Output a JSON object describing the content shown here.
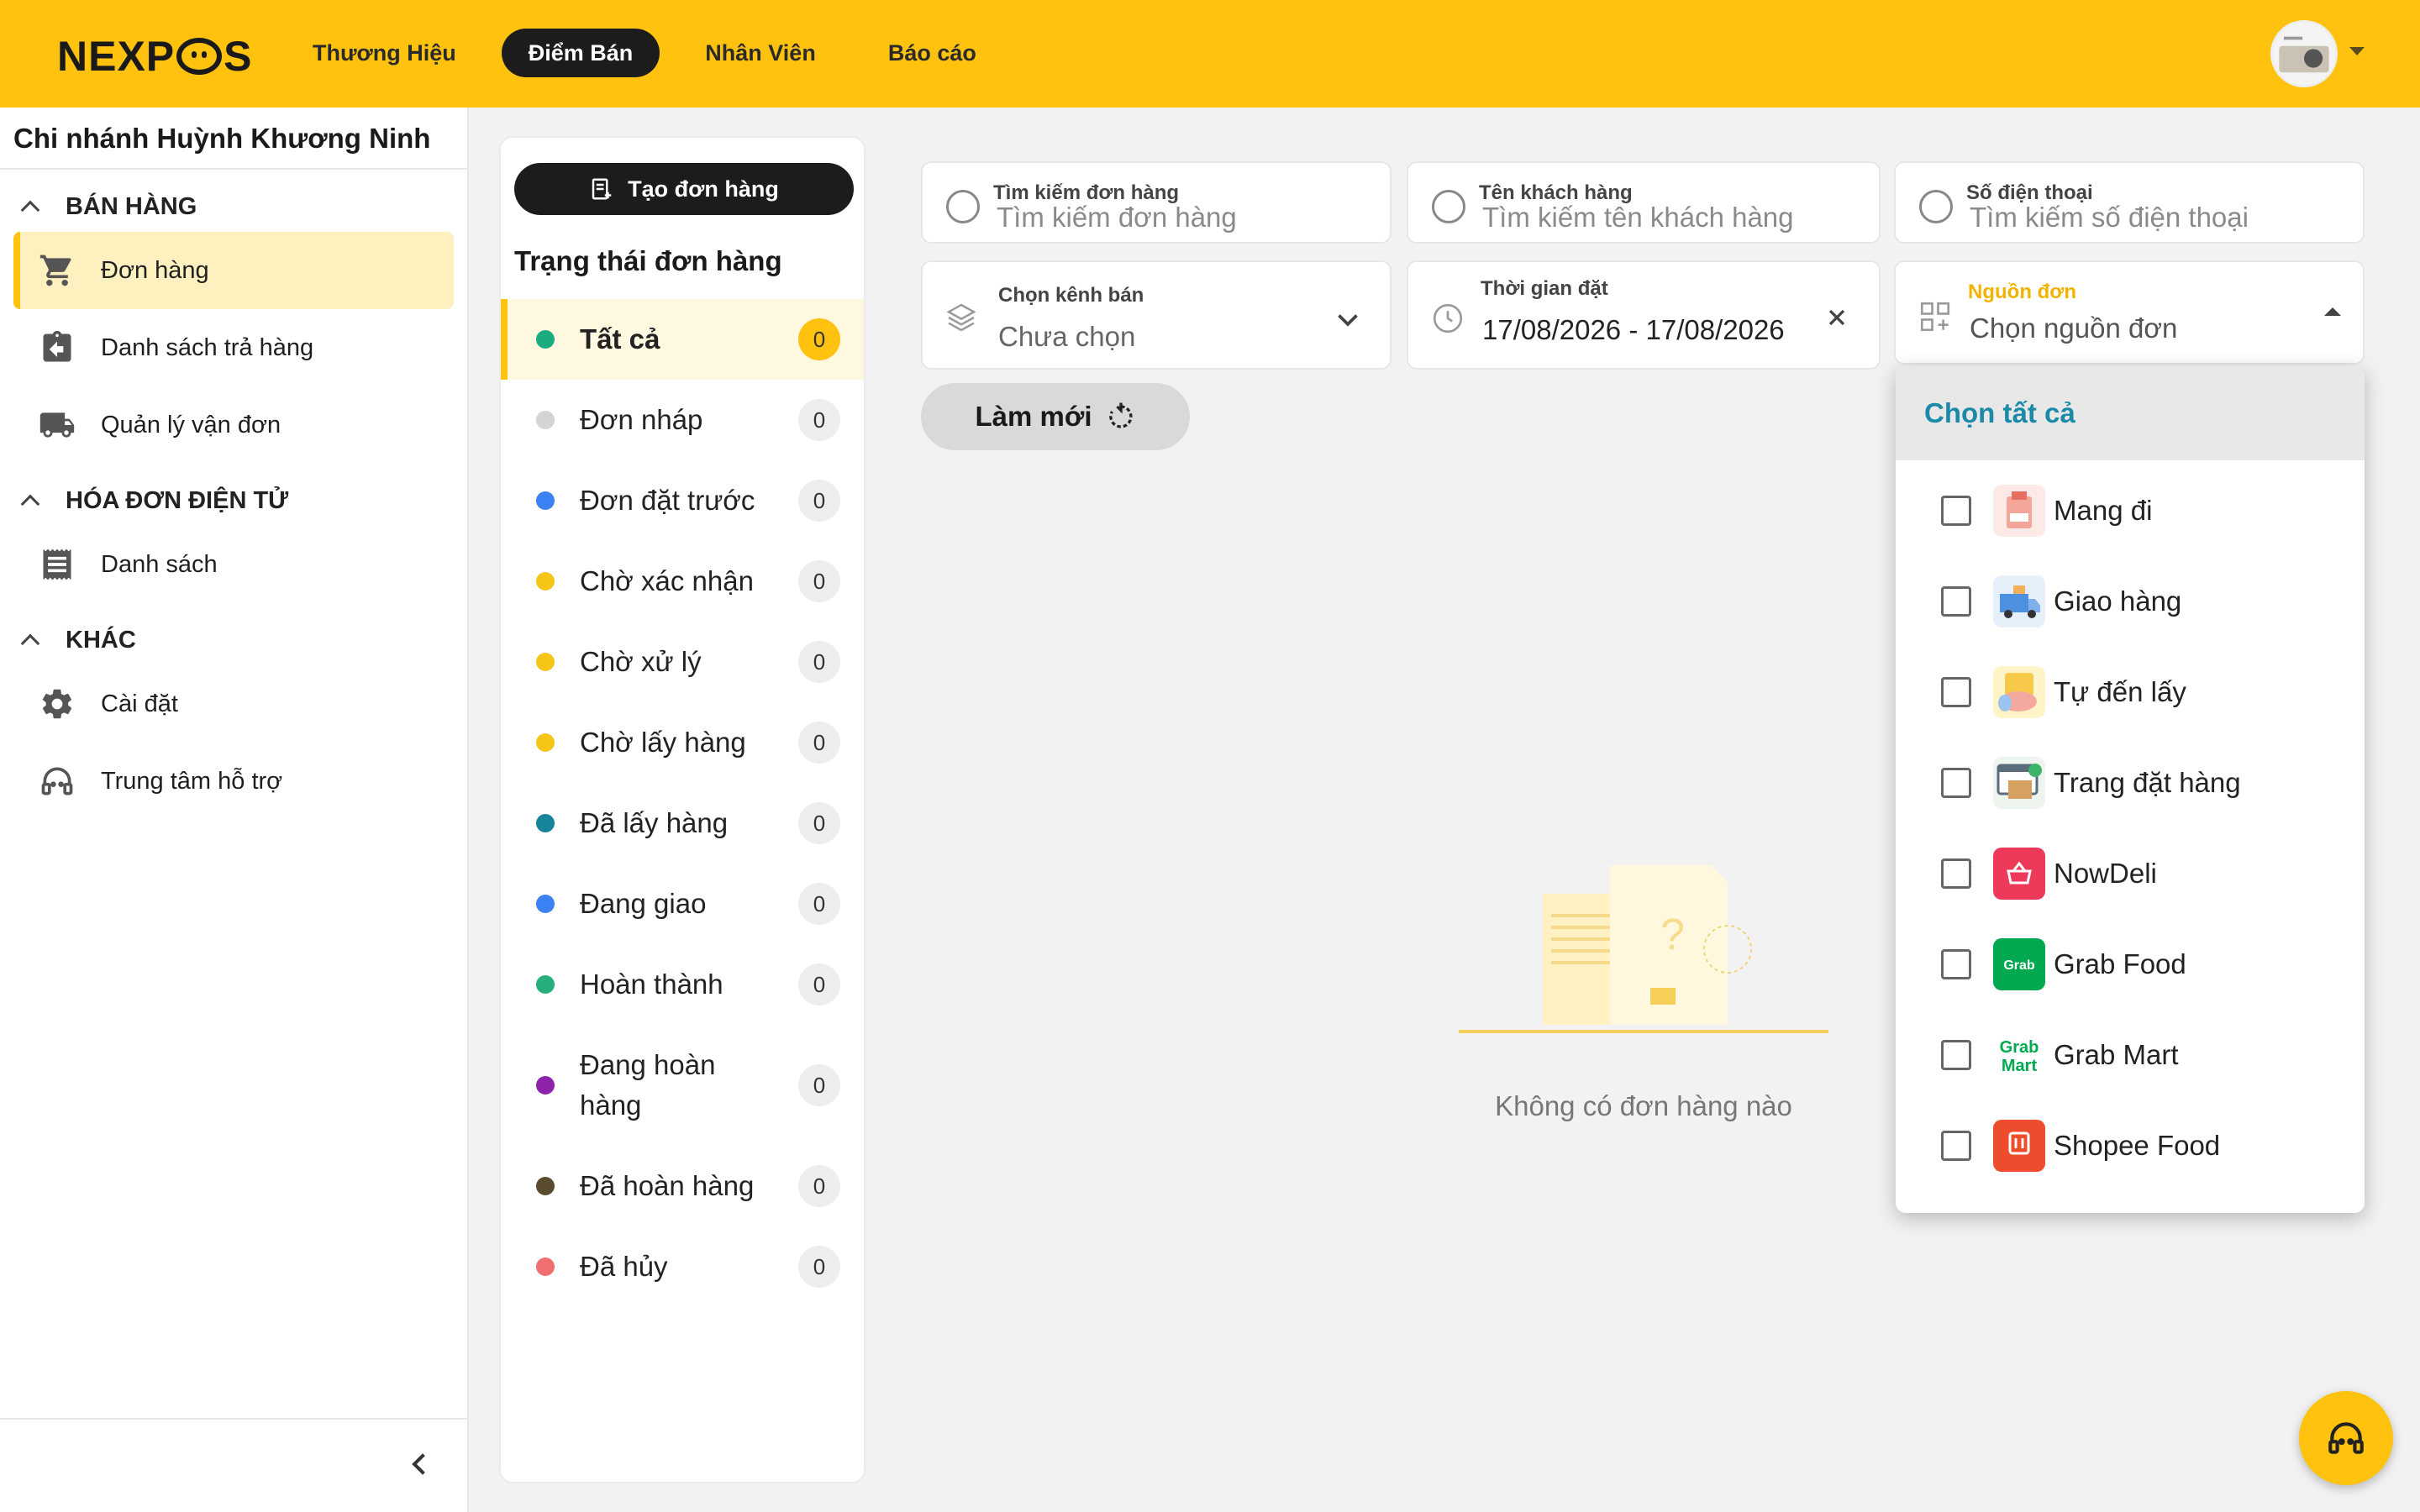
{
  "app": {
    "logo": "NEXPOS"
  },
  "nav": [
    {
      "label": "Thương Hiệu",
      "active": false
    },
    {
      "label": "Điểm Bán",
      "active": true
    },
    {
      "label": "Nhân Viên",
      "active": false
    },
    {
      "label": "Báo cáo",
      "active": false
    }
  ],
  "sidebar": {
    "branch": "Chi nhánh Huỳnh Khương Ninh",
    "sections": [
      {
        "title": "BÁN HÀNG",
        "items": [
          {
            "label": "Đơn hàng",
            "icon": "cart-icon"
          },
          {
            "label": "Danh sách trả hàng",
            "icon": "return-clipboard-icon"
          },
          {
            "label": "Quản lý vận đơn",
            "icon": "truck-icon"
          }
        ]
      },
      {
        "title": "HÓA ĐƠN ĐIỆN TỬ",
        "items": [
          {
            "label": "Danh sách",
            "icon": "receipt-icon"
          }
        ]
      },
      {
        "title": "KHÁC",
        "items": [
          {
            "label": "Cài đặt",
            "icon": "gear-icon"
          },
          {
            "label": "Trung tâm hỗ trợ",
            "icon": "headset-icon"
          }
        ]
      }
    ]
  },
  "status_panel": {
    "create_label": "Tạo đơn hàng",
    "title": "Trạng thái đơn hàng",
    "items": [
      {
        "label": "Tất cả",
        "count": "0",
        "color": "#1aab80"
      },
      {
        "label": "Đơn nháp",
        "count": "0",
        "color": "#d4d4d4"
      },
      {
        "label": "Đơn đặt trước",
        "count": "0",
        "color": "#3b82f6"
      },
      {
        "label": "Chờ xác nhận",
        "count": "0",
        "color": "#f5c518"
      },
      {
        "label": "Chờ xử lý",
        "count": "0",
        "color": "#f5c518"
      },
      {
        "label": "Chờ lấy hàng",
        "count": "0",
        "color": "#f5c518"
      },
      {
        "label": "Đã lấy hàng",
        "count": "0",
        "color": "#16849a"
      },
      {
        "label": "Đang giao",
        "count": "0",
        "color": "#3b82f6"
      },
      {
        "label": "Hoàn thành",
        "count": "0",
        "color": "#27ae7a"
      },
      {
        "label": "Đang hoàn hàng",
        "count": "0",
        "color": "#8e24aa"
      },
      {
        "label": "Đã hoàn hàng",
        "count": "0",
        "color": "#5a4a30"
      },
      {
        "label": "Đã hủy",
        "count": "0",
        "color": "#f07070"
      }
    ]
  },
  "filters": {
    "order_search": {
      "label": "Tìm kiếm đơn hàng",
      "placeholder": "Tìm kiếm đơn hàng"
    },
    "customer": {
      "label": "Tên khách hàng",
      "placeholder": "Tìm kiếm tên khách hàng"
    },
    "phone": {
      "label": "Số điện thoại",
      "placeholder": "Tìm kiếm số điện thoại"
    },
    "channel": {
      "label": "Chọn kênh bán",
      "value": "Chưa chọn"
    },
    "date": {
      "label": "Thời gian đặt",
      "value": "17/08/2026 - 17/08/2026"
    },
    "source": {
      "label": "Nguồn đơn",
      "placeholder": "Chọn nguồn đơn"
    },
    "refresh_label": "Làm mới"
  },
  "empty_state": {
    "text": "Không có đơn hàng nào"
  },
  "source_dropdown": {
    "select_all": "Chọn tất cả",
    "options": [
      {
        "label": "Mang đi",
        "icon": "takeaway-icon"
      },
      {
        "label": "Giao hàng",
        "icon": "delivery-van-icon"
      },
      {
        "label": "Tự đến lấy",
        "icon": "pickup-hand-icon"
      },
      {
        "label": "Trang đặt hàng",
        "icon": "order-page-icon"
      },
      {
        "label": "NowDeli",
        "icon": "nowdeli-logo-icon"
      },
      {
        "label": "Grab Food",
        "icon": "grab-food-logo-icon"
      },
      {
        "label": "Grab Mart",
        "icon": "grab-mart-logo-icon"
      },
      {
        "label": "Shopee Food",
        "icon": "shopee-food-logo-icon"
      }
    ]
  },
  "colors": {
    "accent": "#ffc20e",
    "dark": "#1c1c1c",
    "link": "#1b8aa8"
  }
}
